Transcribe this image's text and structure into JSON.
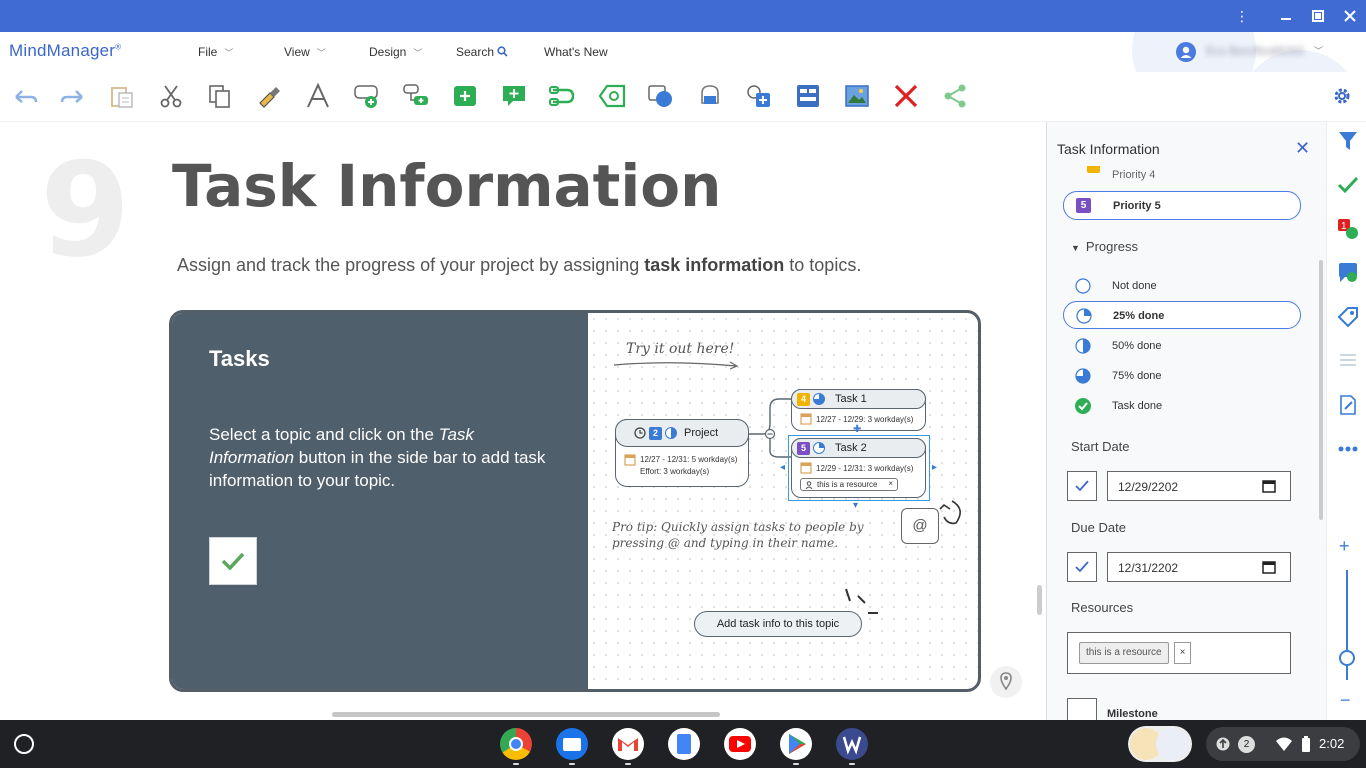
{
  "app": {
    "name": "MindManager",
    "mark": "®"
  },
  "window_controls": [
    "more-menu",
    "minimize",
    "maximize",
    "close"
  ],
  "menu": [
    {
      "label": "File",
      "has_chevron": true
    },
    {
      "label": "View",
      "has_chevron": true
    },
    {
      "label": "Design",
      "has_chevron": true
    },
    {
      "label": "Search",
      "has_chevron": false
    },
    {
      "label": "What's New",
      "has_chevron": false
    }
  ],
  "account": {
    "name": "Ecs Bercffeaf6093"
  },
  "toolbar": [
    "undo",
    "redo",
    "paste",
    "cut",
    "copy",
    "format-painter",
    "text-style",
    "add-topic",
    "add-subtopic",
    "floating-topic",
    "callout",
    "relationship",
    "boundary",
    "shape",
    "fill",
    "image-shape",
    "topic-layout",
    "image",
    "delete",
    "share"
  ],
  "page": {
    "number": "9",
    "title": "Task Information",
    "subtitle_pre": "Assign and track the progress of your project by assigning ",
    "subtitle_bold": "task information",
    "subtitle_post": " to topics.",
    "card": {
      "heading": "Tasks",
      "body_pre": "Select a topic and click on the ",
      "body_em": "Task Information",
      "body_post": " button in the side bar to add task information to your topic."
    },
    "diagram": {
      "try": "Try it out here!",
      "project": {
        "label": "Project",
        "priority": "2",
        "dates": "12/27 - 12/31: 5 workday(s)",
        "effort": "Effort: 3 workday(s)"
      },
      "task1": {
        "label": "Task 1",
        "priority": "4",
        "dates": "12/27 - 12/29: 3 workday(s)"
      },
      "task2": {
        "label": "Task 2",
        "priority": "5",
        "dates": "12/29 - 12/31: 3 workday(s)",
        "resource": "this is a resource"
      },
      "tip": "Pro tip: Quickly assign tasks to people by pressing @ and typing in their name.",
      "at": "@",
      "add_button": "Add task info to this topic"
    }
  },
  "panel": {
    "title": "Task Information",
    "priority_partial": "Priority 4",
    "priority_selected": "Priority 5",
    "progress_header": "Progress",
    "progress_options": [
      {
        "label": "Not done",
        "selected": false
      },
      {
        "label": "25% done",
        "selected": true
      },
      {
        "label": "50% done",
        "selected": false
      },
      {
        "label": "75% done",
        "selected": false
      },
      {
        "label": "Task done",
        "selected": false
      }
    ],
    "start_label": "Start Date",
    "start_value": "12/29/2202",
    "due_label": "Due Date",
    "due_value": "12/31/2202",
    "resources_label": "Resources",
    "resource_chip": "this is a resource",
    "chip_remove": "×",
    "milestone_label": "Milestone"
  },
  "taskbar": {
    "apps": [
      "Chrome",
      "Files",
      "Gmail",
      "Docs",
      "YouTube",
      "Play Store",
      "MindManager"
    ],
    "notifications": "2",
    "time": "2:02"
  },
  "colors": {
    "titlebar": "#3f6bd3",
    "accent": "#3b67c9",
    "card_dark": "#505f6c",
    "green": "#2eae54",
    "red": "#e02020"
  }
}
